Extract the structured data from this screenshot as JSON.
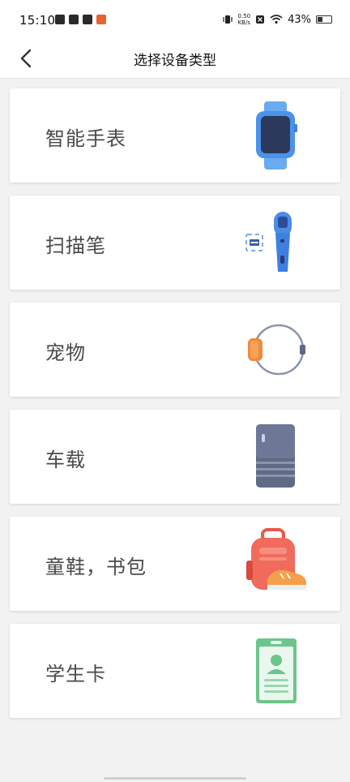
{
  "status_bar": {
    "time": "15:10",
    "net_speed_value": "0.50",
    "net_speed_unit": "KB/s",
    "battery_percent": "43%",
    "battery_level": 0.43
  },
  "header": {
    "title": "选择设备类型"
  },
  "device_types": [
    {
      "label": "智能手表",
      "icon": "smartwatch-icon"
    },
    {
      "label": "扫描笔",
      "icon": "scan-pen-icon"
    },
    {
      "label": "宠物",
      "icon": "pet-collar-icon"
    },
    {
      "label": "车载",
      "icon": "car-device-icon"
    },
    {
      "label": "童鞋，书包",
      "icon": "backpack-shoe-icon"
    },
    {
      "label": "学生卡",
      "icon": "student-card-icon"
    }
  ],
  "colors": {
    "accent_blue": "#3d8fe8",
    "watch_screen": "#2b3a5c",
    "pet_orange": "#f08a3c",
    "car_device": "#5f6b85",
    "backpack_red": "#f06b5c",
    "card_green": "#6cc58a"
  }
}
